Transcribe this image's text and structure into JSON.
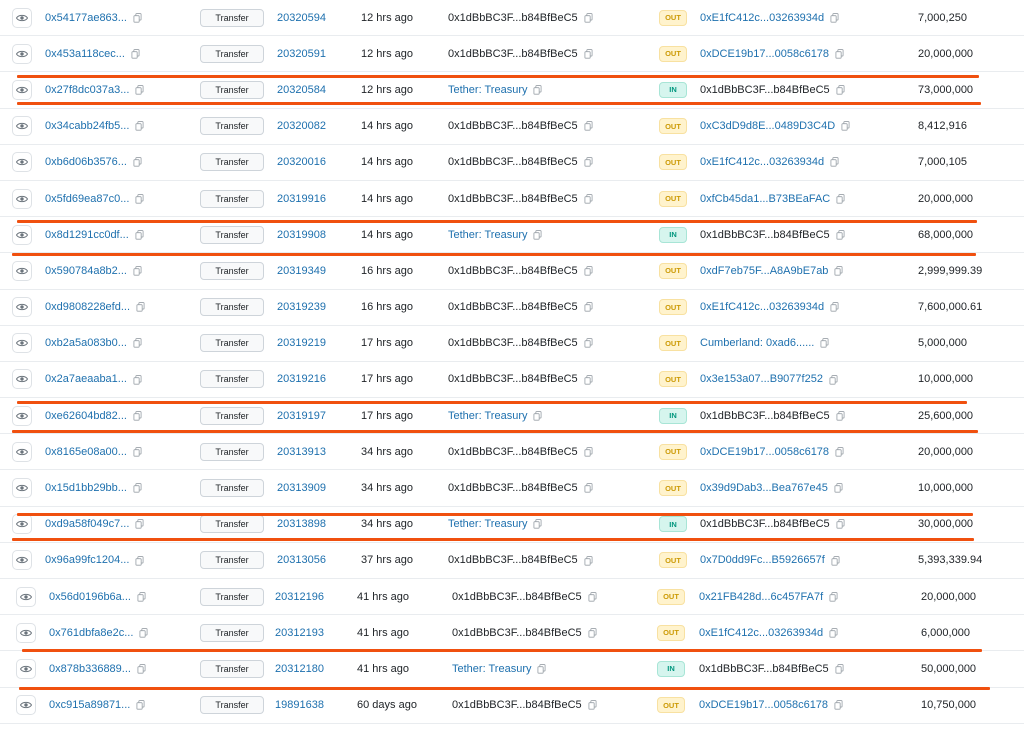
{
  "rows": [
    {
      "hash": "0x54177ae863...",
      "method": "Transfer",
      "block": "20320594",
      "age": "12 hrs ago",
      "from": "0x1dBbBC3F...b84BfBeC5",
      "dir": "OUT",
      "to": "0xE1fC412c...03263934d",
      "qty": "7,000,250"
    },
    {
      "hash": "0x453a118cec...",
      "method": "Transfer",
      "block": "20320591",
      "age": "12 hrs ago",
      "from": "0x1dBbBC3F...b84BfBeC5",
      "dir": "OUT",
      "to": "0xDCE19b17...0058c6178",
      "qty": "20,000,000"
    },
    {
      "hash": "0x27f8dc037a3...",
      "method": "Transfer",
      "block": "20320584",
      "age": "12 hrs ago",
      "from": "Tether: Treasury",
      "dir": "IN",
      "to": "0x1dBbBC3F...b84BfBeC5",
      "qty": "73,000,000"
    },
    {
      "hash": "0x34cabb24fb5...",
      "method": "Transfer",
      "block": "20320082",
      "age": "14 hrs ago",
      "from": "0x1dBbBC3F...b84BfBeC5",
      "dir": "OUT",
      "to": "0xC3dD9d8E...0489D3C4D",
      "qty": "8,412,916"
    },
    {
      "hash": "0xb6d06b3576...",
      "method": "Transfer",
      "block": "20320016",
      "age": "14 hrs ago",
      "from": "0x1dBbBC3F...b84BfBeC5",
      "dir": "OUT",
      "to": "0xE1fC412c...03263934d",
      "qty": "7,000,105"
    },
    {
      "hash": "0x5fd69ea87c0...",
      "method": "Transfer",
      "block": "20319916",
      "age": "14 hrs ago",
      "from": "0x1dBbBC3F...b84BfBeC5",
      "dir": "OUT",
      "to": "0xfCb45da1...B73BEaFAC",
      "qty": "20,000,000"
    },
    {
      "hash": "0x8d1291cc0df...",
      "method": "Transfer",
      "block": "20319908",
      "age": "14 hrs ago",
      "from": "Tether: Treasury",
      "dir": "IN",
      "to": "0x1dBbBC3F...b84BfBeC5",
      "qty": "68,000,000"
    },
    {
      "hash": "0x590784a8b2...",
      "method": "Transfer",
      "block": "20319349",
      "age": "16 hrs ago",
      "from": "0x1dBbBC3F...b84BfBeC5",
      "dir": "OUT",
      "to": "0xdF7eb75F...A8A9bE7ab",
      "qty": "2,999,999.39"
    },
    {
      "hash": "0xd9808228efd...",
      "method": "Transfer",
      "block": "20319239",
      "age": "16 hrs ago",
      "from": "0x1dBbBC3F...b84BfBeC5",
      "dir": "OUT",
      "to": "0xE1fC412c...03263934d",
      "qty": "7,600,000.61"
    },
    {
      "hash": "0xb2a5a083b0...",
      "method": "Transfer",
      "block": "20319219",
      "age": "17 hrs ago",
      "from": "0x1dBbBC3F...b84BfBeC5",
      "dir": "OUT",
      "to": "Cumberland: 0xad6......",
      "qty": "5,000,000"
    },
    {
      "hash": "0x2a7aeaaba1...",
      "method": "Transfer",
      "block": "20319216",
      "age": "17 hrs ago",
      "from": "0x1dBbBC3F...b84BfBeC5",
      "dir": "OUT",
      "to": "0x3e153a07...B9077f252",
      "qty": "10,000,000"
    },
    {
      "hash": "0xe62604bd82...",
      "method": "Transfer",
      "block": "20319197",
      "age": "17 hrs ago",
      "from": "Tether: Treasury",
      "dir": "IN",
      "to": "0x1dBbBC3F...b84BfBeC5",
      "qty": "25,600,000"
    },
    {
      "hash": "0x8165e08a00...",
      "method": "Transfer",
      "block": "20313913",
      "age": "34 hrs ago",
      "from": "0x1dBbBC3F...b84BfBeC5",
      "dir": "OUT",
      "to": "0xDCE19b17...0058c6178",
      "qty": "20,000,000"
    },
    {
      "hash": "0x15d1bb29bb...",
      "method": "Transfer",
      "block": "20313909",
      "age": "34 hrs ago",
      "from": "0x1dBbBC3F...b84BfBeC5",
      "dir": "OUT",
      "to": "0x39d9Dab3...Bea767e45",
      "qty": "10,000,000"
    },
    {
      "hash": "0xd9a58f049c7...",
      "method": "Transfer",
      "block": "20313898",
      "age": "34 hrs ago",
      "from": "Tether: Treasury",
      "dir": "IN",
      "to": "0x1dBbBC3F...b84BfBeC5",
      "qty": "30,000,000"
    },
    {
      "hash": "0x96a99fc1204...",
      "method": "Transfer",
      "block": "20313056",
      "age": "37 hrs ago",
      "from": "0x1dBbBC3F...b84BfBeC5",
      "dir": "OUT",
      "to": "0x7D0dd9Fc...B5926657f",
      "qty": "5,393,339.94"
    },
    {
      "hash": "0x56d0196b6a...",
      "method": "Transfer",
      "block": "20312196",
      "age": "41 hrs ago",
      "from": "0x1dBbBC3F...b84BfBeC5",
      "dir": "OUT",
      "to": "0x21FB428d...6c457FA7f",
      "qty": "20,000,000"
    },
    {
      "hash": "0x761dbfa8e2c...",
      "method": "Transfer",
      "block": "20312193",
      "age": "41 hrs ago",
      "from": "0x1dBbBC3F...b84BfBeC5",
      "dir": "OUT",
      "to": "0xE1fC412c...03263934d",
      "qty": "6,000,000"
    },
    {
      "hash": "0x878b336889...",
      "method": "Transfer",
      "block": "20312180",
      "age": "41 hrs ago",
      "from": "Tether: Treasury",
      "dir": "IN",
      "to": "0x1dBbBC3F...b84BfBeC5",
      "qty": "50,000,000"
    },
    {
      "hash": "0xc915a89871...",
      "method": "Transfer",
      "block": "19891638",
      "age": "60 days ago",
      "from": "0x1dBbBC3F...b84BfBeC5",
      "dir": "OUT",
      "to": "0xDCE19b17...0058c6178",
      "qty": "10,750,000"
    }
  ],
  "icons": {
    "eye": "eye-icon",
    "copy": "copy-icon"
  },
  "colors": {
    "link": "#1e70ae",
    "out_badge": "#fff3cd",
    "in_badge": "#d6f5ee",
    "highlight": "#f0500f"
  }
}
